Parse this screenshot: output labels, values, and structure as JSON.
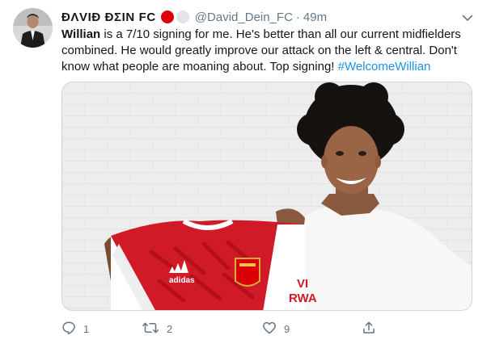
{
  "tweet": {
    "display_name": "ĐΛVIĐ ĐΣIN FC",
    "handle": "@David_Dein_FC",
    "separator": "·",
    "time": "49m",
    "text_bold": "Willian",
    "text_body": " is a 7/10 signing for me. He's better than all our current midfielders combined. He would greatly improve our attack on the left & central. Don't know what people are moaning about. Top signing! ",
    "hashtag": "#WelcomeWillian",
    "media": {
      "shirt_sponsor_partial": "VI\nRWA",
      "shirt_brand": "adidas",
      "crest_text": "Arsenal"
    }
  },
  "actions": {
    "reply_count": "1",
    "retweet_count": "2",
    "like_count": "9"
  },
  "colors": {
    "link": "#1b95e0",
    "muted": "#657786",
    "arsenal_red": "#db0007"
  },
  "icons": [
    "chevron-down-icon",
    "reply-icon",
    "retweet-icon",
    "like-icon",
    "share-icon"
  ]
}
